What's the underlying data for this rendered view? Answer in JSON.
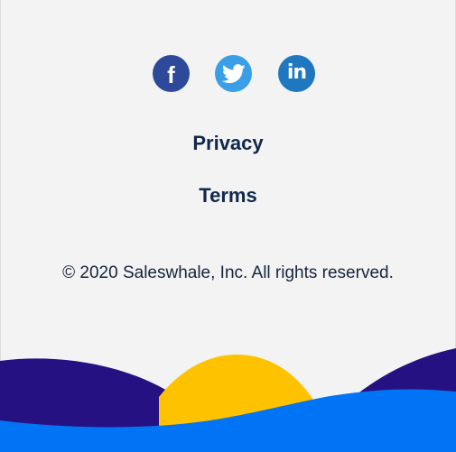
{
  "social": {
    "links": [
      {
        "network": "facebook",
        "icon": "facebook-icon",
        "glyph": "f",
        "color": "#2d4a9a"
      },
      {
        "network": "twitter",
        "icon": "twitter-bird-icon",
        "color": "#3a9fe6"
      },
      {
        "network": "linkedin",
        "icon": "linkedin-icon",
        "glyph": "in",
        "color": "#1f78bf"
      }
    ]
  },
  "links": {
    "privacy": "Privacy",
    "terms": "Terms"
  },
  "copyright": "© 2020 Saleswhale, Inc. All rights reserved.",
  "colors": {
    "background": "#f3f3f3",
    "link_text": "#10284a",
    "wave_dark": "#261183",
    "sun": "#fec200",
    "wave_blue": "#0074f5"
  }
}
